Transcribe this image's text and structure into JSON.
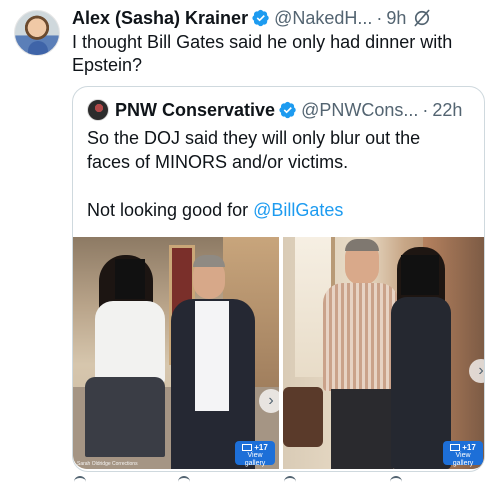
{
  "tweet": {
    "author_name": "Alex (Sasha) Krainer",
    "handle": "@NakedH...",
    "separator": "·",
    "time": "9h",
    "text": "I thought Bill Gates said he only had dinner with Epstein?"
  },
  "quote": {
    "author_name": "PNW Conservative",
    "handle": "@PNWCons...",
    "separator": "·",
    "time": "22h",
    "lines": [
      "So the DOJ said they will only blur out the",
      "faces of MINORS and/or victims.",
      "",
      "Not looking good for "
    ],
    "mention": "@BillGates"
  },
  "media": {
    "photo1": {
      "gallery_count": "+17",
      "gallery_label": "View gallery",
      "credit": "Sarah Oldridge Corrections"
    },
    "photo2": {
      "gallery_count": "+17",
      "gallery_label": "View gallery"
    },
    "chevron": "›"
  },
  "colors": {
    "verified": "#1d9bf0",
    "link": "#1d9bf0",
    "secondary_text": "#536471",
    "border": "#cfd9de"
  },
  "icons": {
    "verified": "verified-badge-icon",
    "grok": "grok-icon",
    "chevron": "chevron-right-icon",
    "gallery": "gallery-icon"
  }
}
